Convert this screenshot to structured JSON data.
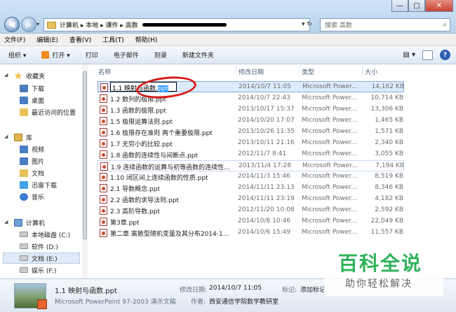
{
  "window": {
    "address_text": "计算机 ▸ 本地 ▸ 课件 ▸ 高数",
    "search_placeholder": "搜索 高数",
    "btn_minimize": "—",
    "btn_maximize": "□",
    "btn_close": "✕"
  },
  "menubar": [
    "文件(F)",
    "编辑(E)",
    "查看(V)",
    "工具(T)",
    "帮助(H)"
  ],
  "toolbar": {
    "organize": "组织 ▾",
    "open": "打开 ▾",
    "print": "打印",
    "email": "电子邮件",
    "burn": "刻录",
    "new_folder": "新建文件夹"
  },
  "navpane": {
    "favorites": "收藏夹",
    "download": "下载",
    "desktop": "桌面",
    "recent": "最近访问的位置",
    "libraries": "库",
    "video": "视频",
    "pictures": "图片",
    "documents": "文档",
    "thunder": "迅雷下载",
    "music": "音乐",
    "computer": "计算机",
    "drive_c": "本地磁盘 (C:)",
    "drive_d": "软件 (D:)",
    "drive_e": "文档 (E:)",
    "drive_f": "娱乐 (F:)"
  },
  "columns": {
    "name": "名称",
    "date": "修改日期",
    "type": "类型",
    "size": "大小"
  },
  "rename": {
    "prefix": "1.1 映射与函数.",
    "selected": "ppt"
  },
  "files": [
    {
      "name": "1.1 映射与函数.ppt",
      "date": "2014/10/7 11:05",
      "type": "Microsoft Power...",
      "size": "14,162 KB"
    },
    {
      "name": "1.2 数列的极限.ppt",
      "date": "2014/10/7 22:43",
      "type": "Microsoft Power...",
      "size": "10,714 KB"
    },
    {
      "name": "1.3 函数的极限.ppt",
      "date": "2013/10/17 15:37",
      "type": "Microsoft Power...",
      "size": "13,306 KB"
    },
    {
      "name": "1.5 极限运算法则.ppt",
      "date": "2014/10/20 17:07",
      "type": "Microsoft Power...",
      "size": "1,465 KB"
    },
    {
      "name": "1.6 极限存在准则 两个重要极限.ppt",
      "date": "2013/10/26 11:35",
      "type": "Microsoft Power...",
      "size": "1,571 KB"
    },
    {
      "name": "1.7 无穷小的比较.ppt",
      "date": "2013/10/11 21:16",
      "type": "Microsoft Power...",
      "size": "2,340 KB"
    },
    {
      "name": "1.8 函数的连续性与间断点.ppt",
      "date": "2012/11/7 8:41",
      "type": "Microsoft Power...",
      "size": "3,055 KB"
    },
    {
      "name": "1.9 连续函数的运算与初等函数的连续性...",
      "date": "2013/11/4 17:28",
      "type": "Microsoft Power...",
      "size": "7,194 KB"
    },
    {
      "name": "1.10 闭区间上连续函数的性质.ppt",
      "date": "2014/11/3 15:46",
      "type": "Microsoft Power...",
      "size": "8,519 KB"
    },
    {
      "name": "2.1 导数概念.ppt",
      "date": "2014/11/11 23:13",
      "type": "Microsoft Power...",
      "size": "8,346 KB"
    },
    {
      "name": "2.2 函数的求导法则.ppt",
      "date": "2014/11/11 23:19",
      "type": "Microsoft Power...",
      "size": "4,182 KB"
    },
    {
      "name": "2.3 高阶导数.ppt",
      "date": "2012/11/20 10:08",
      "type": "Microsoft Power...",
      "size": "2,592 KB"
    },
    {
      "name": "第3章.ppt",
      "date": "2014/10/8 10:46",
      "type": "Microsoft Power...",
      "size": "22,049 KB"
    },
    {
      "name": "第二章 离散型随机变量及其分布2014-1...",
      "date": "2014/10/6 15:49",
      "type": "Microsoft Power...",
      "size": "11,557 KB"
    }
  ],
  "details": {
    "filename": "1.1 映射与函数.ppt",
    "filetype": "Microsoft PowerPoint 97-2003 演示文稿",
    "modified_label": "修改日期:",
    "modified_value": "2014/10/7 11:05",
    "author_label": "作者:",
    "author_value": "西安通信学院数学教研室",
    "tags_label": "标记:",
    "tags_value": "添加标记"
  },
  "watermark": {
    "title": "百科全说",
    "subtitle": "助你轻松解决"
  }
}
